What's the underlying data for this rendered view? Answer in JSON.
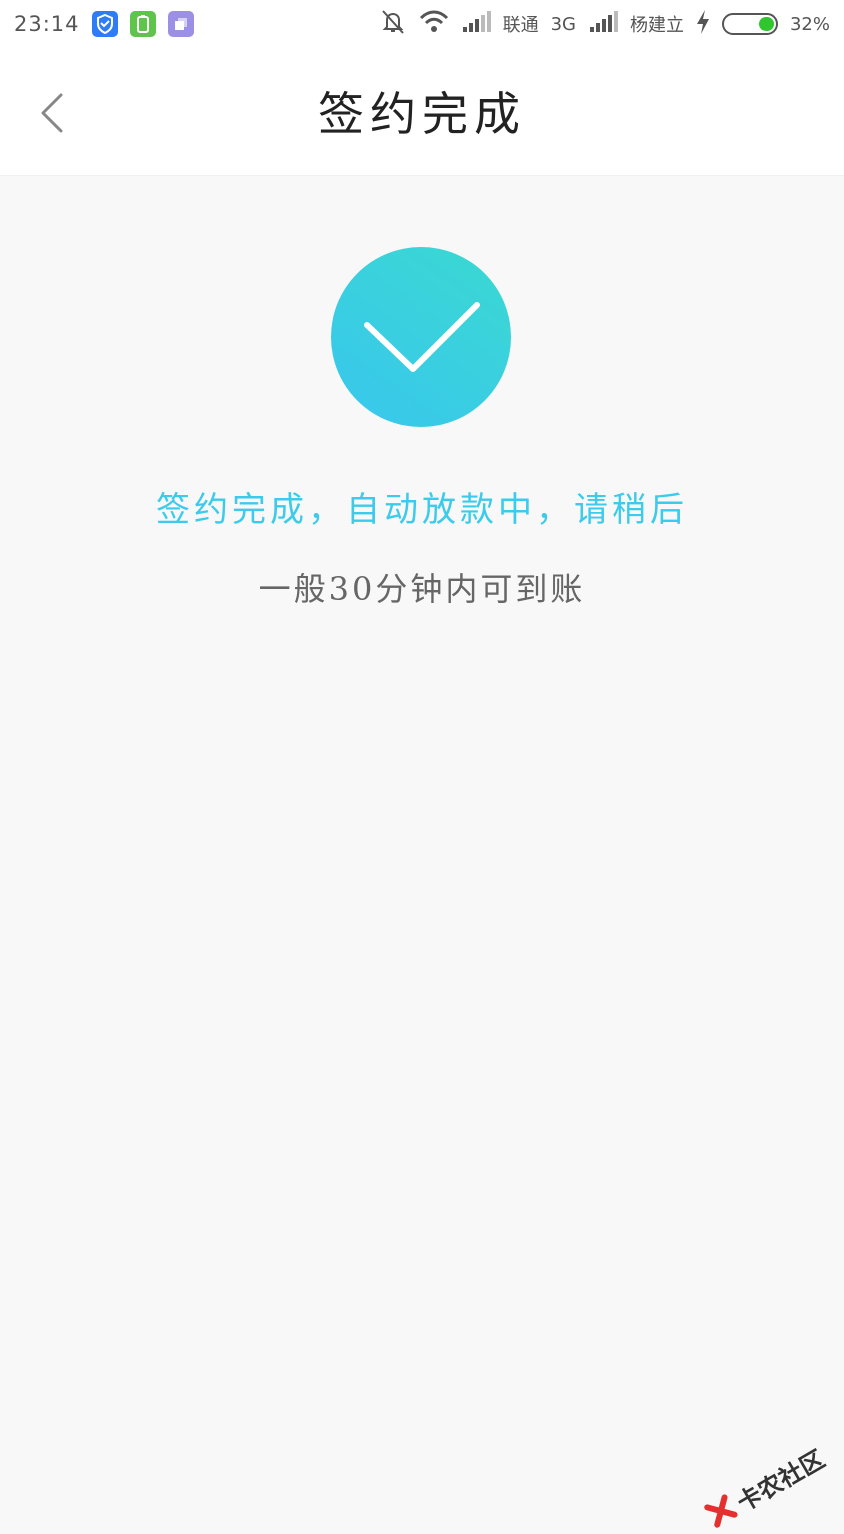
{
  "status_bar": {
    "time": "23:14",
    "carrier1": "联通",
    "network_type": "3G",
    "carrier2": "杨建立",
    "battery_percent": "32%",
    "battery_level": 0.32,
    "icons": [
      "shield-app-icon",
      "battery-app-icon",
      "files-app-icon",
      "mute-bell-icon",
      "wifi-icon",
      "signal-icon",
      "signal-icon",
      "charging-icon",
      "battery-icon"
    ]
  },
  "header": {
    "title": "签约完成",
    "back_icon": "chevron-left-icon"
  },
  "result": {
    "icon": "checkmark-icon",
    "message": "签约完成，自动放款中，请稍后",
    "sub_message": "一般30分钟内可到账"
  },
  "watermark": {
    "text": "卡农社区"
  },
  "colors": {
    "accent": "#3ccbea",
    "gradient_start": "#39c6ee",
    "gradient_end": "#3ad9d1",
    "background": "#f8f8f8"
  }
}
